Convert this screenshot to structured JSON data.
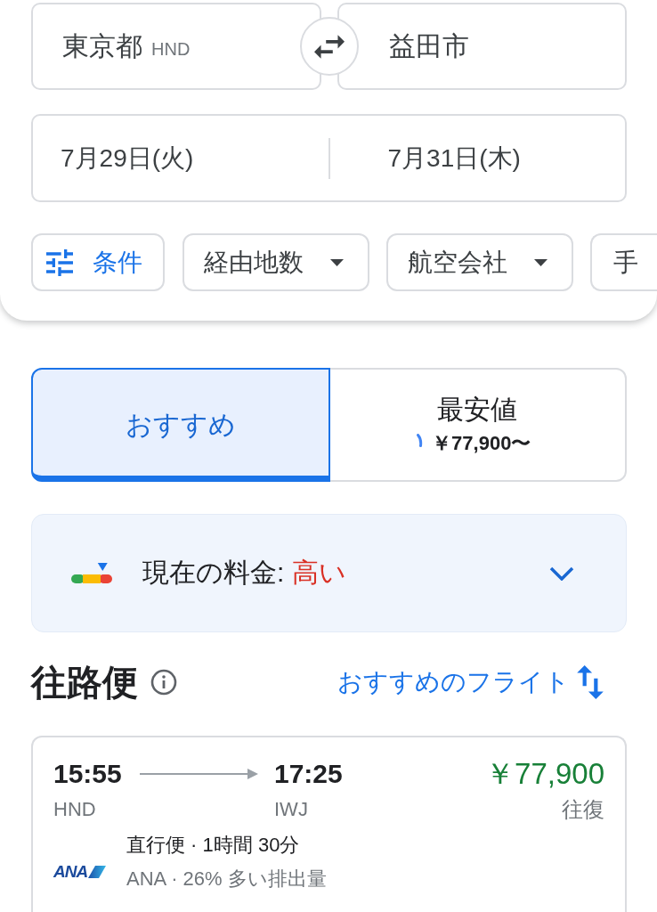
{
  "search": {
    "origin": {
      "city": "東京都",
      "code": "HND"
    },
    "destination": {
      "city": "益田市"
    },
    "departure_date": "7月29日(火)",
    "return_date": "7月31日(木)"
  },
  "filters": [
    {
      "kind": "all_filters",
      "label": "条件",
      "dropdown": false
    },
    {
      "kind": "filter",
      "label": "経由地数",
      "dropdown": true
    },
    {
      "kind": "filter",
      "label": "航空会社",
      "dropdown": true
    },
    {
      "kind": "filter",
      "label": "手",
      "dropdown": false
    }
  ],
  "sort_tabs": [
    {
      "label": "おすすめ",
      "selected": true,
      "loading": false
    },
    {
      "label": "最安値",
      "price": "￥77,900〜",
      "selected": false,
      "loading": true
    }
  ],
  "price_insight": {
    "label": "現在の料金:",
    "value": "高い",
    "level": 0.85,
    "expanded": false
  },
  "outbound": {
    "title": "往路便",
    "sort_label": "おすすめのフライト"
  },
  "flights": [
    {
      "departure_time": "15:55",
      "departure_airport": "HND",
      "arrival_time": "17:25",
      "arrival_airport": "IWJ",
      "price": "￥77,900",
      "price_note": "往復",
      "airline_logo": "ANA",
      "summary": "直行便 · 1時間 30分",
      "details": "ANA · 26% 多い排出量"
    }
  ]
}
